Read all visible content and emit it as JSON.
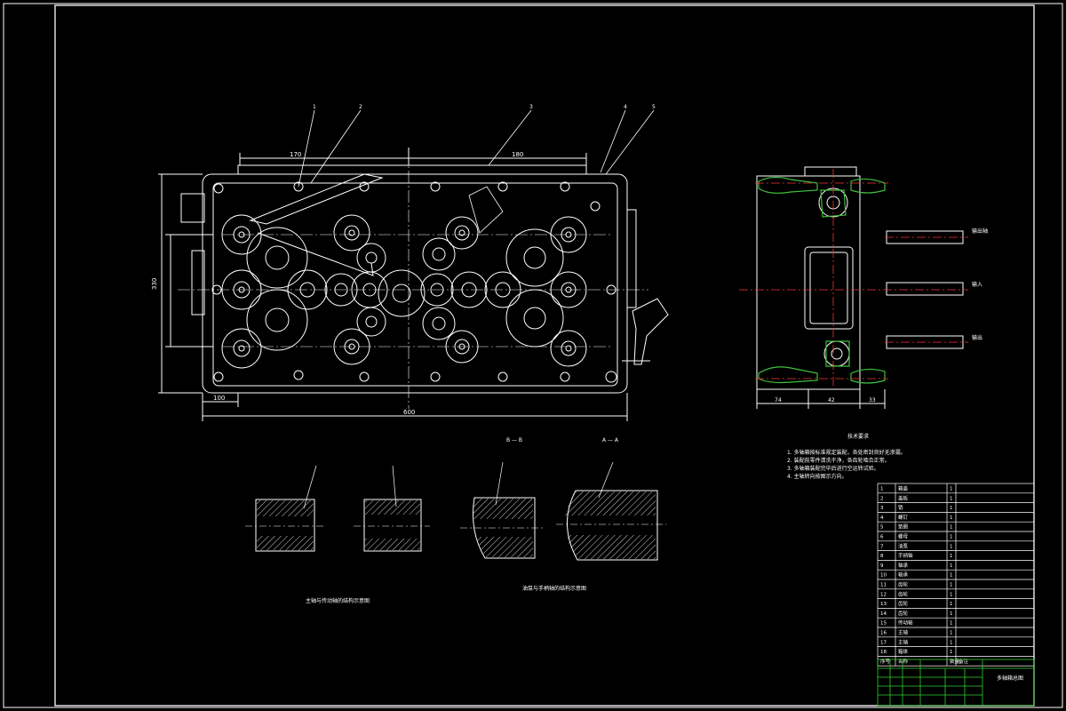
{
  "drawing": {
    "colors": {
      "background": "#000000",
      "line": "#ffffff",
      "centerline": "#ff3030",
      "hatch": "#3fbf3f",
      "title_block_line": "#30d030"
    },
    "balloons": [
      "1",
      "2",
      "3",
      "4",
      "5"
    ],
    "dimensions": {
      "main_width": "600",
      "main_height": "330",
      "left_offset": "100",
      "top_left": "170",
      "top_right": "180",
      "side_left": "74",
      "side_mid": "42",
      "side_right": "33"
    },
    "section_labels": [
      "B — B",
      "A — A"
    ],
    "side_labels": [
      "输出轴",
      "输入",
      "输出"
    ],
    "notes_title": "技术要求",
    "notes": [
      "1. 多轴箱按标准规定装配，各处密封良好无渗漏。",
      "2. 装配前零件清洗干净，各齿轮啮合正常。",
      "3. 多轴箱装配完毕后进行空运转试验。",
      "4. 主轴转向按图示方向。"
    ],
    "captions": [
      "主轴与传动轴的结构示意图",
      "油泵与手柄轴的结构示意图"
    ],
    "parts_table": {
      "header": [
        "序号",
        "名称",
        "数量",
        "备注"
      ],
      "rows": [
        [
          "18",
          "箱体",
          "1",
          ""
        ],
        [
          "17",
          "主轴",
          "1",
          ""
        ],
        [
          "16",
          "主轴",
          "1",
          ""
        ],
        [
          "15",
          "传动轴",
          "1",
          ""
        ],
        [
          "14",
          "齿轮",
          "1",
          ""
        ],
        [
          "13",
          "齿轮",
          "1",
          ""
        ],
        [
          "12",
          "齿轮",
          "1",
          ""
        ],
        [
          "11",
          "齿轮",
          "1",
          ""
        ],
        [
          "10",
          "轴承",
          "1",
          ""
        ],
        [
          "9",
          "轴承",
          "1",
          ""
        ],
        [
          "8",
          "手柄轴",
          "1",
          ""
        ],
        [
          "7",
          "油泵",
          "1",
          ""
        ],
        [
          "6",
          "螺母",
          "1",
          ""
        ],
        [
          "5",
          "垫圈",
          "1",
          ""
        ],
        [
          "4",
          "螺钉",
          "1",
          ""
        ],
        [
          "3",
          "销",
          "1",
          ""
        ],
        [
          "2",
          "盖板",
          "1",
          ""
        ],
        [
          "1",
          "箱盖",
          "1",
          ""
        ]
      ]
    },
    "title_block": {
      "title": "多轴箱总图"
    }
  }
}
